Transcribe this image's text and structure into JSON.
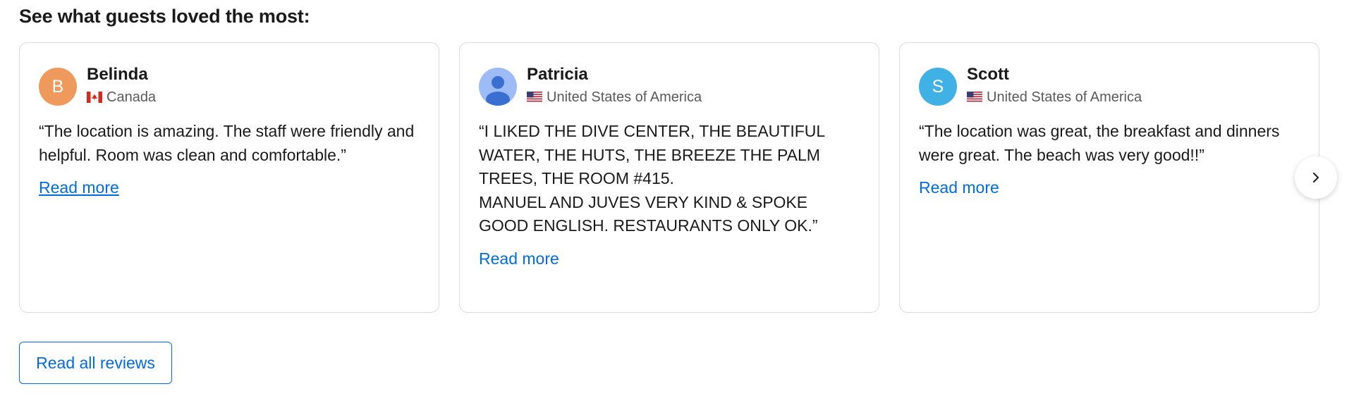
{
  "section": {
    "title": "See what guests loved the most:"
  },
  "reviews": [
    {
      "name": "Belinda",
      "initial": "B",
      "avatar_color": "#ef9a5c",
      "flag_icon": "canada-flag-icon",
      "country": "Canada",
      "quote": "“The location is amazing. The staff were friendly and helpful. Room was clean and comfortable.”",
      "read_more": "Read more"
    },
    {
      "name": "Patricia",
      "initial": "",
      "avatar_color": "#9dbbf5",
      "flag_icon": "usa-flag-icon",
      "country": "United States of America",
      "quote": "“I LIKED THE DIVE CENTER, THE BEAUTIFUL WATER, THE HUTS, THE BREEZE THE PALM TREES, THE ROOM #415.\nMANUEL AND JUVES VERY KIND & SPOKE GOOD ENGLISH. RESTAURANTS ONLY OK.”",
      "read_more": "Read more"
    },
    {
      "name": "Scott",
      "initial": "S",
      "avatar_color": "#3fb1e5",
      "flag_icon": "usa-flag-icon",
      "country": "United States of America",
      "quote": "“The location was great, the breakfast and dinners were great. The beach was very good!!”",
      "read_more": "Read more"
    }
  ],
  "carousel": {
    "next_icon": "chevron-right-icon"
  },
  "actions": {
    "read_all_label": "Read all reviews"
  },
  "colors": {
    "link": "#006ce4",
    "card_border": "#dcdcdc"
  }
}
